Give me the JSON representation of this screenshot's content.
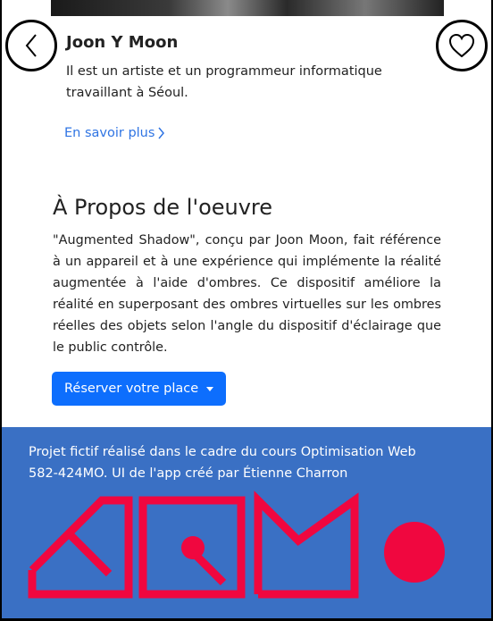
{
  "artist": {
    "name": "Joon Y Moon",
    "description": "Il est un artiste et un programmeur informatique travaillant à Séoul.",
    "learn_more_label": "En savoir plus"
  },
  "about": {
    "title": "À Propos de l'oeuvre",
    "body": "\"Augmented Shadow\", conçu par Joon Moon, fait référence à un appareil et à une expérience qui implémente la réalité augmentée à l'aide d'ombres. Ce dispositif améliore la réalité en superposant des ombres virtuelles sur les ombres réelles des objets selon l'angle du dispositif d'éclairage que le public contrôle.",
    "reserve_label": "Réserver votre place"
  },
  "footer": {
    "text": "Projet fictif réalisé dans le cadre du cours Optimisation Web 582-424MO. UI de l'app créé par Étienne Charron"
  },
  "icons": {
    "back": "chevron-left-icon",
    "favorite": "heart-icon",
    "learn_more": "chevron-right-icon",
    "reserve": "caret-down-icon"
  },
  "colors": {
    "link": "#2f74e3",
    "primary_button": "#0d6efd",
    "footer_bg": "#3a70c4",
    "logo": "#f0073f"
  }
}
